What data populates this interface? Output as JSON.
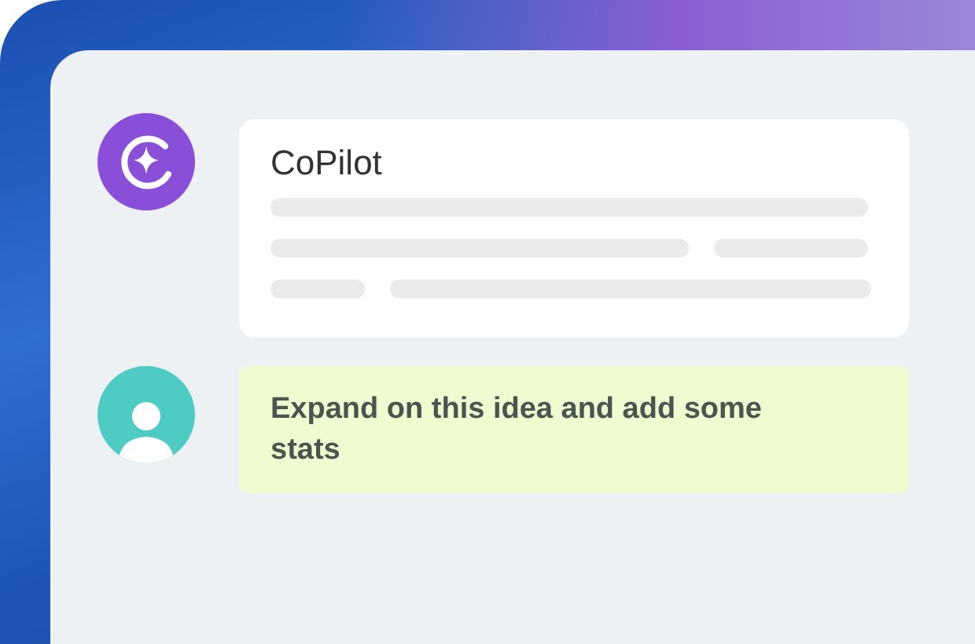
{
  "messages": [
    {
      "kind": "bot",
      "sender": "CoPilot"
    },
    {
      "kind": "user",
      "text": "Expand on this idea and add some stats"
    }
  ]
}
